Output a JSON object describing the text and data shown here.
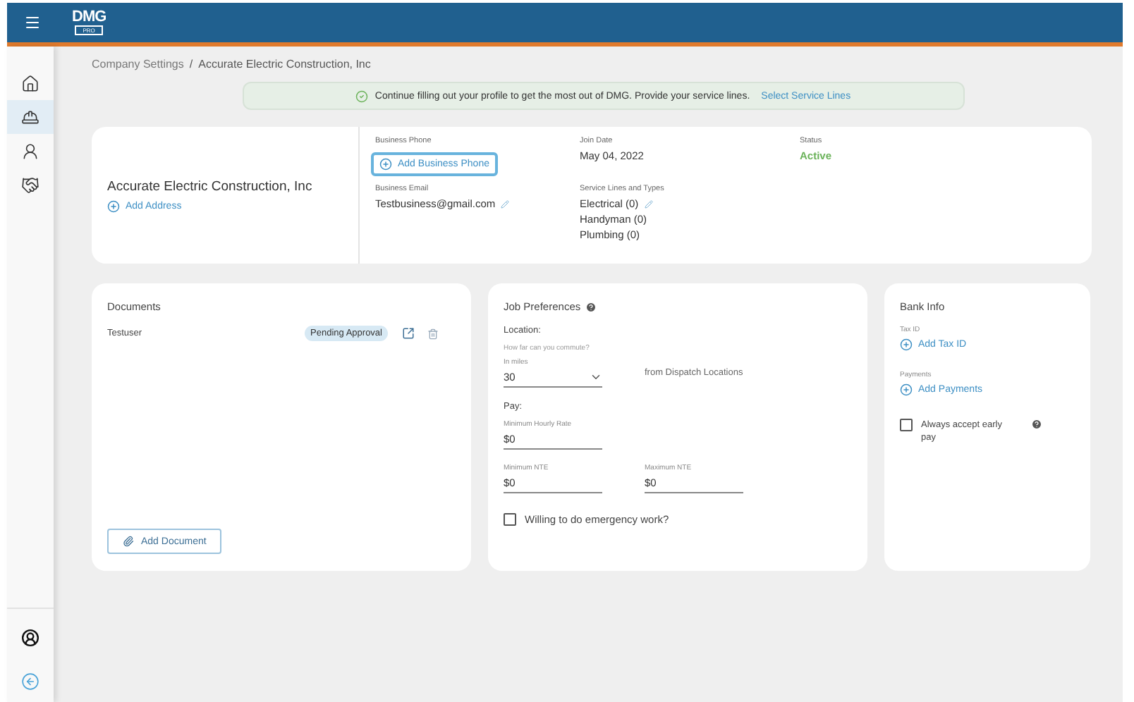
{
  "header": {
    "logo": "DMG",
    "logo_sub": "PRO"
  },
  "sidebar": {
    "items": [
      {
        "selected": false
      },
      {
        "selected": true
      },
      {
        "selected": false
      },
      {
        "selected": false
      }
    ]
  },
  "breadcrumb": {
    "parent": "Company Settings",
    "separator": "/",
    "current": "Accurate Electric Construction, Inc"
  },
  "banner": {
    "message": "Continue filling out your profile to get the most out of DMG. Provide your service lines.",
    "link": "Select Service Lines"
  },
  "company": {
    "name": "Accurate Electric Construction, Inc",
    "add_address": "Add Address",
    "phone_label": "Business Phone",
    "add_phone": "Add Business Phone",
    "email_label": "Business Email",
    "email": "Testbusiness@gmail.com",
    "join_label": "Join Date",
    "join_date": "May 04, 2022",
    "status_label": "Status",
    "status": "Active",
    "service_label": "Service Lines and Types",
    "service_lines": [
      "Electrical (0)",
      "Handyman (0)",
      "Plumbing (0)"
    ]
  },
  "documents": {
    "title": "Documents",
    "items": [
      {
        "name": "Testuser",
        "badge": "Pending Approval"
      }
    ],
    "add_button": "Add Document"
  },
  "job_preferences": {
    "title": "Job Preferences",
    "location_label": "Location:",
    "commute_hint": "How far can you commute?",
    "miles_label": "In miles",
    "miles_value": "30",
    "miles_suffix": "from Dispatch Locations",
    "pay_label": "Pay:",
    "min_rate_label": "Minimum Hourly Rate",
    "min_rate": "$0",
    "min_nte_label": "Minimum NTE",
    "min_nte": "$0",
    "max_nte_label": "Maximum NTE",
    "max_nte": "$0",
    "emergency": {
      "label": "Willing to do emergency work?",
      "checked": false
    }
  },
  "bank_info": {
    "title": "Bank Info",
    "tax_label": "Tax ID",
    "add_tax": "Add Tax ID",
    "payments_label": "Payments",
    "add_payments": "Add Payments",
    "early_pay": {
      "label": "Always accept early pay",
      "checked": false
    }
  }
}
